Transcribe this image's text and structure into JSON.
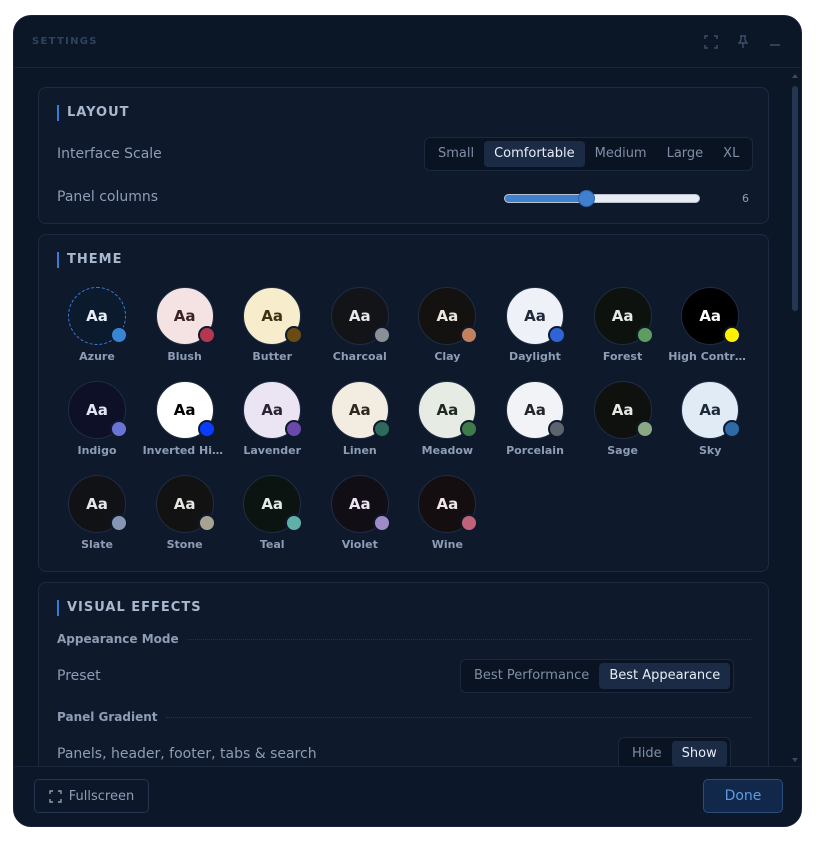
{
  "window": {
    "title": "SETTINGS"
  },
  "layout": {
    "title": "LAYOUT",
    "interface_scale": {
      "label": "Interface Scale",
      "options": [
        "Small",
        "Comfortable",
        "Medium",
        "Large",
        "XL"
      ],
      "selected": "Comfortable"
    },
    "panel_columns": {
      "label": "Panel columns",
      "value": "6",
      "fraction": 0.42
    }
  },
  "theme": {
    "title": "THEME",
    "sample_text": "Aa",
    "selected": "Azure",
    "items": [
      {
        "name": "Azure",
        "bg": "#0c1a2e",
        "fg": "#e8eef7",
        "dot": "#3a84d4"
      },
      {
        "name": "Blush",
        "bg": "#f5e3e3",
        "fg": "#3a2226",
        "dot": "#b5364f"
      },
      {
        "name": "Butter",
        "bg": "#f7eccc",
        "fg": "#3b3114",
        "dot": "#6a4b12"
      },
      {
        "name": "Charcoal",
        "bg": "#121418",
        "fg": "#e5e7ea",
        "dot": "#8a9098"
      },
      {
        "name": "Clay",
        "bg": "#141210",
        "fg": "#ece6e0",
        "dot": "#c2805e"
      },
      {
        "name": "Daylight",
        "bg": "#eef2f8",
        "fg": "#1d2838",
        "dot": "#2f63d6"
      },
      {
        "name": "Forest",
        "bg": "#0d120e",
        "fg": "#e3ebe3",
        "dot": "#5e9d5f"
      },
      {
        "name": "High Contrast",
        "bg": "#000000",
        "fg": "#ffffff",
        "dot": "#fff200"
      },
      {
        "name": "Indigo",
        "bg": "#0e1028",
        "fg": "#e4e6f7",
        "dot": "#6a73d6"
      },
      {
        "name": "Inverted High Contrast",
        "bg": "#ffffff",
        "fg": "#000000",
        "dot": "#0a3cff"
      },
      {
        "name": "Lavender",
        "bg": "#ebe4f3",
        "fg": "#2b2236",
        "dot": "#6a4aa8"
      },
      {
        "name": "Linen",
        "bg": "#f3ece0",
        "fg": "#2d2820",
        "dot": "#2e6a5c"
      },
      {
        "name": "Meadow",
        "bg": "#e6ece4",
        "fg": "#1f2a1e",
        "dot": "#3e7a4a"
      },
      {
        "name": "Porcelain",
        "bg": "#f1f3f6",
        "fg": "#22262c",
        "dot": "#5a636e"
      },
      {
        "name": "Sage",
        "bg": "#0e110e",
        "fg": "#e3e8e1",
        "dot": "#8aa886"
      },
      {
        "name": "Sky",
        "bg": "#e0ebf5",
        "fg": "#1c2a38",
        "dot": "#2e6aa6"
      },
      {
        "name": "Slate",
        "bg": "#101216",
        "fg": "#e4e7eb",
        "dot": "#8796b4"
      },
      {
        "name": "Stone",
        "bg": "#121212",
        "fg": "#e7e5e1",
        "dot": "#a8a290"
      },
      {
        "name": "Teal",
        "bg": "#0c1412",
        "fg": "#e1ecea",
        "dot": "#5fb0a8"
      },
      {
        "name": "Violet",
        "bg": "#120e16",
        "fg": "#ebe4f0",
        "dot": "#a08ac8"
      },
      {
        "name": "Wine",
        "bg": "#140e10",
        "fg": "#efe4e6",
        "dot": "#c2627a"
      }
    ]
  },
  "visual_effects": {
    "title": "VISUAL EFFECTS",
    "appearance_mode": {
      "heading": "Appearance Mode",
      "preset_label": "Preset",
      "options": [
        "Best Performance",
        "Best Appearance"
      ],
      "selected": "Best Appearance"
    },
    "panel_gradient": {
      "heading": "Panel Gradient",
      "row_label": "Panels, header, footer, tabs & search",
      "options": [
        "Hide",
        "Show"
      ],
      "selected": "Show"
    }
  },
  "footer": {
    "fullscreen_label": "Fullscreen",
    "done_label": "Done"
  },
  "colors": {
    "accent": "#3a7bd5",
    "window_bg": "#0b1627",
    "card_bg": "#0e1a2c"
  }
}
